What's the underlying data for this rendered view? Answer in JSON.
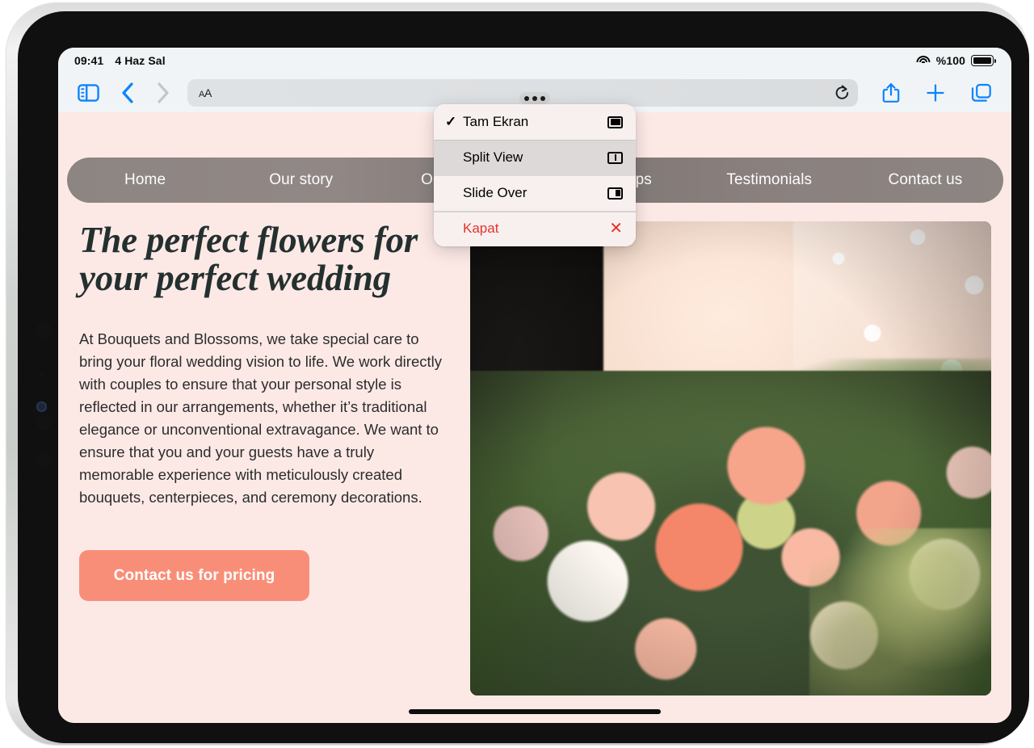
{
  "status_bar": {
    "time": "09:41",
    "date": "4 Haz Sal",
    "wifi_icon": "wifi-icon",
    "battery_percent": "%100",
    "battery_icon": "battery-full-icon"
  },
  "toolbar": {
    "sidebar_icon": "sidebar-icon",
    "back_icon": "chevron-left-icon",
    "forward_icon": "chevron-right-icon",
    "text_size_label": "AA",
    "reload_icon": "reload-icon",
    "share_icon": "share-icon",
    "new_tab_icon": "plus-icon",
    "tabs_icon": "tabs-icon",
    "address_placeholder": ""
  },
  "multitask": {
    "grabber_name": "multitasking-grabber",
    "items": [
      {
        "label": "Tam Ekran",
        "checked": "✓",
        "glyph": "full-screen-icon",
        "selected": false
      },
      {
        "label": "Split View",
        "checked": "",
        "glyph": "split-view-icon",
        "selected": true
      },
      {
        "label": "Slide Over",
        "checked": "",
        "glyph": "slide-over-icon",
        "selected": false
      },
      {
        "label": "Kapat",
        "checked": "",
        "glyph": "close-x-icon",
        "selected": false,
        "destructive": true
      }
    ]
  },
  "site": {
    "nav": [
      {
        "label": "Home"
      },
      {
        "label": "Our story"
      },
      {
        "label": "Occasions"
      },
      {
        "label": "Workshops"
      },
      {
        "label": "Testimonials"
      },
      {
        "label": "Contact us"
      }
    ],
    "hero": {
      "title_line1": "The perfect flowers for",
      "title_line2": "your perfect wedding",
      "body": "At Bouquets and Blossoms, we take special care to bring your floral wedding vision to life. We work directly with couples to ensure that your personal style is reflected in our arrangements, whether it’s traditional elegance or unconventional extravagance. We want to ensure that you and your guests have a truly memorable experience with meticulously created bouquets, centerpieces, and ceremony decorations.",
      "cta_label": "Contact us for pricing",
      "photo_alt": "wedding-bouquet-photo"
    }
  },
  "colors": {
    "page_background": "#fce9e6",
    "nav_bar": "#8a817f",
    "cta_button": "#f98e78",
    "heading_text": "#23302f",
    "accent_blue": "#0b84fe",
    "destructive_red": "#e63329",
    "toolbar_background": "#f1f4f6",
    "menu_background": "#f7f0ef",
    "menu_selected_row": "#ddd9d8"
  }
}
